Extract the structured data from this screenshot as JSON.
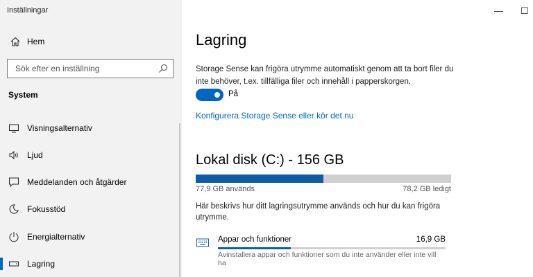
{
  "window": {
    "title": "Inställningar",
    "minimize": "—",
    "maximize": "☐"
  },
  "sidebar": {
    "home_label": "Hem",
    "search_placeholder": "Sök efter en inställning",
    "section_title": "System",
    "items": [
      {
        "label": "Visningsalternativ",
        "icon": "display-icon"
      },
      {
        "label": "Ljud",
        "icon": "speaker-icon"
      },
      {
        "label": "Meddelanden och åtgärder",
        "icon": "notifications-icon"
      },
      {
        "label": "Fokusstöd",
        "icon": "moon-icon"
      },
      {
        "label": "Energialternativ",
        "icon": "power-icon"
      },
      {
        "label": "Lagring",
        "icon": "storage-icon",
        "active": true
      }
    ]
  },
  "main": {
    "title": "Lagring",
    "storage_sense_desc": "Storage Sense kan frigöra utrymme automatiskt genom att ta bort filer du inte behöver, t.ex. tillfälliga filer och innehåll i papperskorgen.",
    "toggle_state": "on",
    "toggle_label": "På",
    "configure_link": "Konfigurera Storage Sense eller kör det nu",
    "disk_title": "Lokal disk (C:) - 156 GB",
    "disk_used_fraction": 0.499,
    "used_text": "77,9 GB används",
    "free_text": "78,2 GB ledigt",
    "usage_desc": "Här beskrivs hur ditt lagringsutrymme används och hur du kan frigöra utrymme.",
    "categories": [
      {
        "name": "Appar och funktioner",
        "size": "16,9 GB",
        "fraction": 0.32,
        "desc": "Avinstallera appar och funktioner som du inte använder eller inte vill ha"
      }
    ]
  },
  "colors": {
    "accent": "#0067c0",
    "bar_fill": "#0f5ca4",
    "bar_bg": "#d0d0d0",
    "sidebar_bg": "#f2f2f2"
  }
}
